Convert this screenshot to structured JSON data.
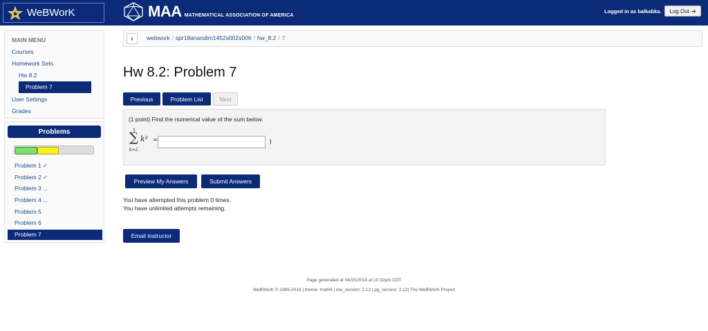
{
  "header": {
    "app_title": "WeBWorK",
    "maa_title": "MAA",
    "maa_subtitle": "MATHEMATICAL ASSOCIATION OF AMERICA",
    "logged_in": "Logged in as balkabka.",
    "logout_label": "Log Out"
  },
  "sidebar": {
    "menu_label": "MAIN MENU",
    "items": [
      "Courses",
      "Homework Sets",
      "Hw 8.2",
      "Problem 7",
      "User Settings",
      "Grades"
    ],
    "problems_header": "Problems",
    "progress": {
      "correct_fraction": 0.29,
      "partial_fraction": 0.28
    },
    "problems": [
      "Problem 1 ✓",
      "Problem 2 ✓",
      "Problem 3 ...",
      "Problem 4 ...",
      "Problem 5",
      "Problem 6",
      "Problem 7"
    ]
  },
  "breadcrumb": {
    "items": [
      "webwork",
      "spr18anandim1452s002s006",
      "hw_8.2",
      "7"
    ]
  },
  "page_title": "Hw 8.2: Problem 7",
  "nav": {
    "previous": "Previous",
    "problem_list": "Problem List",
    "next": "Next"
  },
  "problem": {
    "text": "(1 point) Find the numerical value of the sum below.",
    "sum_upper": "5",
    "sum_lower": "k=2",
    "sum_term": "k²",
    "equals": "=",
    "answer_value": ""
  },
  "actions": {
    "preview": "Preview My Answers",
    "submit": "Submit Answers"
  },
  "attempts": {
    "line1": "You have attempted this problem 0 times.",
    "line2": "You have unlimited attempts remaining."
  },
  "email_label": "Email instructor",
  "footer": {
    "generated": "Page generated at 04/15/2018 at 10:22pm CDT",
    "credits": "WeBWorK © 1996-2016 | theme: math4 | ww_version: 2.12 | pg_version: 2.12| The WeBWorK Project"
  },
  "colors": {
    "brand": "#0b2a78",
    "link": "#1b4a8a",
    "correct": "#7be06f",
    "partial": "#f6f12a"
  }
}
